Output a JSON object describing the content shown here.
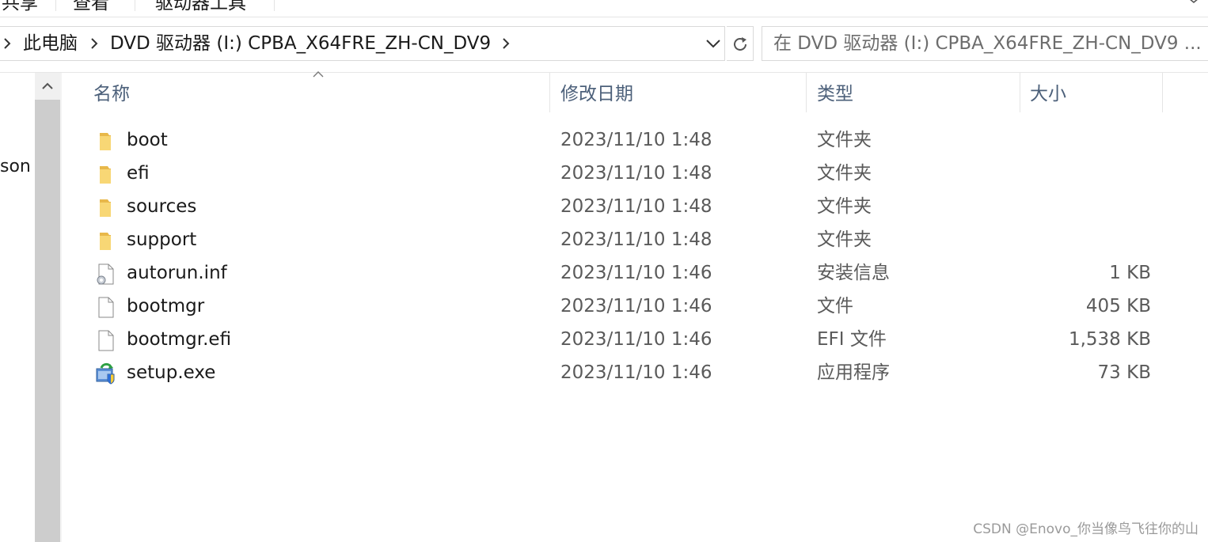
{
  "ribbon": {
    "tabs": [
      "共享",
      "查看",
      "驱动器工具"
    ]
  },
  "address_bar": {
    "crumbs": [
      "此电脑",
      "DVD 驱动器 (I:) CPBA_X64FRE_ZH-CN_DV9"
    ]
  },
  "search": {
    "placeholder": "在 DVD 驱动器 (I:) CPBA_X64FRE_ZH-CN_DV9 ..."
  },
  "nav_pane": {
    "partial_label": "son"
  },
  "columns": {
    "name": "名称",
    "modified": "修改日期",
    "type": "类型",
    "size": "大小"
  },
  "files": [
    {
      "name": "boot",
      "modified": "2023/11/10 1:48",
      "type": "文件夹",
      "size": "",
      "icon": "folder-icon"
    },
    {
      "name": "efi",
      "modified": "2023/11/10 1:48",
      "type": "文件夹",
      "size": "",
      "icon": "folder-icon"
    },
    {
      "name": "sources",
      "modified": "2023/11/10 1:48",
      "type": "文件夹",
      "size": "",
      "icon": "folder-icon"
    },
    {
      "name": "support",
      "modified": "2023/11/10 1:48",
      "type": "文件夹",
      "size": "",
      "icon": "folder-icon"
    },
    {
      "name": "autorun.inf",
      "modified": "2023/11/10 1:46",
      "type": "安装信息",
      "size": "1 KB",
      "icon": "settings-file-icon"
    },
    {
      "name": "bootmgr",
      "modified": "2023/11/10 1:46",
      "type": "文件",
      "size": "405 KB",
      "icon": "file-icon"
    },
    {
      "name": "bootmgr.efi",
      "modified": "2023/11/10 1:46",
      "type": "EFI 文件",
      "size": "1,538 KB",
      "icon": "file-icon"
    },
    {
      "name": "setup.exe",
      "modified": "2023/11/10 1:46",
      "type": "应用程序",
      "size": "73 KB",
      "icon": "setup-icon"
    }
  ],
  "watermark": "CSDN @Enovo_你当像鸟飞往你的山",
  "colors": {
    "header_text": "#4c607a",
    "folder": "#f8d775",
    "scroll_thumb": "#cdcdcd"
  }
}
